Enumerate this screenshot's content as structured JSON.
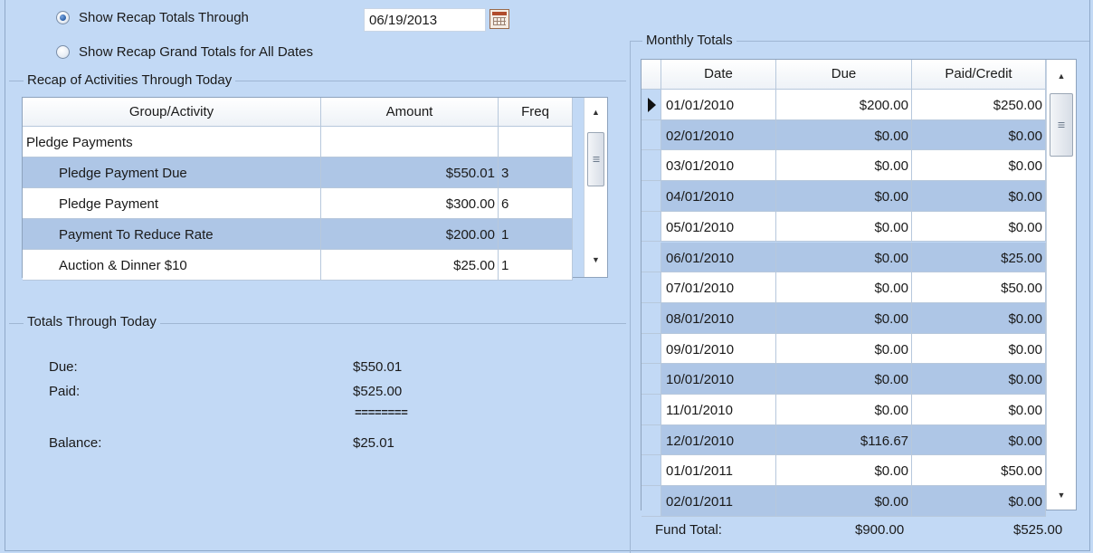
{
  "options": {
    "recap_through_label": "Show Recap Totals Through",
    "recap_through_date": "06/19/2013",
    "grand_totals_label": "Show Recap Grand Totals for All Dates",
    "selected": "recap_through"
  },
  "recap": {
    "title": "Recap of Activities Through Today",
    "columns": [
      "Group/Activity",
      "Amount",
      "Freq"
    ],
    "rows": [
      {
        "activity": "Pledge Payments",
        "amount": "",
        "freq": ""
      },
      {
        "activity": "Pledge Payment Due",
        "amount": "$550.01",
        "freq": "3"
      },
      {
        "activity": "Pledge Payment",
        "amount": "$300.00",
        "freq": "6"
      },
      {
        "activity": "Payment To Reduce Rate",
        "amount": "$200.00",
        "freq": "1"
      },
      {
        "activity": "Auction & Dinner $10",
        "amount": "$25.00",
        "freq": "1"
      }
    ]
  },
  "totals": {
    "title": "Totals Through Today",
    "due_label": "Due:",
    "due_value": "$550.01",
    "paid_label": "Paid:",
    "paid_value": "$525.00",
    "separator": "========",
    "balance_label": "Balance:",
    "balance_value": "$25.01"
  },
  "monthly": {
    "title": "Monthly Totals",
    "columns": [
      "Date",
      "Due",
      "Paid/Credit"
    ],
    "rows": [
      {
        "date": "01/01/2010",
        "due": "$200.00",
        "paid": "$250.00"
      },
      {
        "date": "02/01/2010",
        "due": "$0.00",
        "paid": "$0.00"
      },
      {
        "date": "03/01/2010",
        "due": "$0.00",
        "paid": "$0.00"
      },
      {
        "date": "04/01/2010",
        "due": "$0.00",
        "paid": "$0.00"
      },
      {
        "date": "05/01/2010",
        "due": "$0.00",
        "paid": "$0.00"
      },
      {
        "date": "06/01/2010",
        "due": "$0.00",
        "paid": "$25.00"
      },
      {
        "date": "07/01/2010",
        "due": "$0.00",
        "paid": "$50.00"
      },
      {
        "date": "08/01/2010",
        "due": "$0.00",
        "paid": "$0.00"
      },
      {
        "date": "09/01/2010",
        "due": "$0.00",
        "paid": "$0.00"
      },
      {
        "date": "10/01/2010",
        "due": "$0.00",
        "paid": "$0.00"
      },
      {
        "date": "11/01/2010",
        "due": "$0.00",
        "paid": "$0.00"
      },
      {
        "date": "12/01/2010",
        "due": "$116.67",
        "paid": "$0.00"
      },
      {
        "date": "01/01/2011",
        "due": "$0.00",
        "paid": "$50.00"
      },
      {
        "date": "02/01/2011",
        "due": "$0.00",
        "paid": "$0.00"
      }
    ],
    "fund_total_label": "Fund Total:",
    "fund_total_due": "$900.00",
    "fund_total_paid": "$525.00"
  },
  "colors": {
    "background": "#c2d9f5",
    "row_alt": "#aec6e6",
    "row": "#ffffff"
  }
}
